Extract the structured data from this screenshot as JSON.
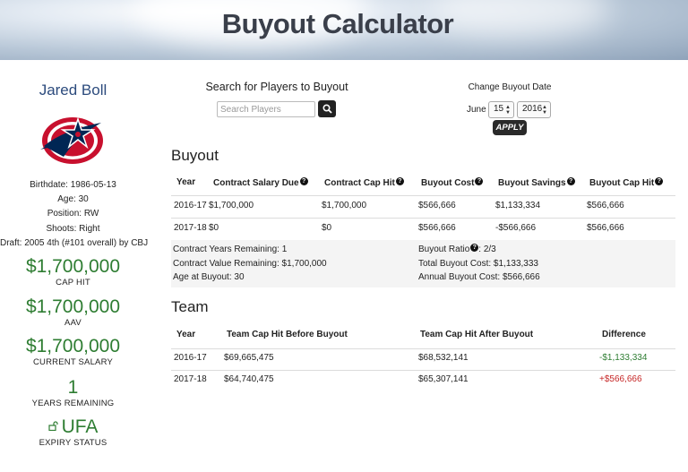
{
  "header": {
    "title": "Buyout Calculator"
  },
  "player": {
    "name": "Jared Boll",
    "team_logo": "columbus-blue-jackets-logo",
    "birthdate": "Birthdate: 1986-05-13",
    "age": "Age: 30",
    "position": "Position: RW",
    "shoots": "Shoots: Right",
    "draft": "Draft: 2005 4th (#101 overall) by CBJ",
    "stats": [
      {
        "value": "$1,700,000",
        "label": "CAP HIT"
      },
      {
        "value": "$1,700,000",
        "label": "AAV"
      },
      {
        "value": "$1,700,000",
        "label": "CURRENT SALARY"
      },
      {
        "value": "1",
        "label": "YEARS REMAINING"
      },
      {
        "value": "UFA",
        "label": "EXPIRY STATUS",
        "icon": "unlock-icon"
      }
    ]
  },
  "search": {
    "title": "Search for Players to Buyout",
    "placeholder": "Search Players",
    "button_icon": "search-icon"
  },
  "buyout_date": {
    "title": "Change Buyout Date",
    "month": "June",
    "day": "15",
    "year": "2016",
    "apply_label": "APPLY"
  },
  "buyout": {
    "title": "Buyout",
    "columns": [
      "Year",
      "Contract Salary Due",
      "Contract Cap Hit",
      "Buyout Cost",
      "Buyout Savings",
      "Buyout Cap Hit"
    ],
    "help_symbol": "?",
    "rows": [
      [
        "2016-17",
        "$1,700,000",
        "$1,700,000",
        "$566,666",
        "$1,133,334",
        "$566,666"
      ],
      [
        "2017-18",
        "$0",
        "$0",
        "$566,666",
        "-$566,666",
        "$566,666"
      ]
    ],
    "summary_left": [
      "Contract Years Remaining: 1",
      "Contract Value Remaining: $1,700,000",
      "Age at Buyout: 30"
    ],
    "summary_ratio_label": "Buyout Ratio",
    "summary_ratio_value": ": 2/3",
    "summary_right": [
      "Total Buyout Cost: $1,133,333",
      "Annual Buyout Cost: $566,666"
    ]
  },
  "team": {
    "title": "Team",
    "columns": [
      "Year",
      "Team Cap Hit Before Buyout",
      "Team Cap Hit After Buyout",
      "Difference"
    ],
    "rows": [
      [
        "2016-17",
        "$69,665,475",
        "$68,532,141",
        "-$1,133,334"
      ],
      [
        "2017-18",
        "$64,740,475",
        "$65,307,141",
        "+$566,666"
      ]
    ],
    "colors": {
      "negative": "#2e7d32",
      "positive": "#c62828"
    }
  }
}
